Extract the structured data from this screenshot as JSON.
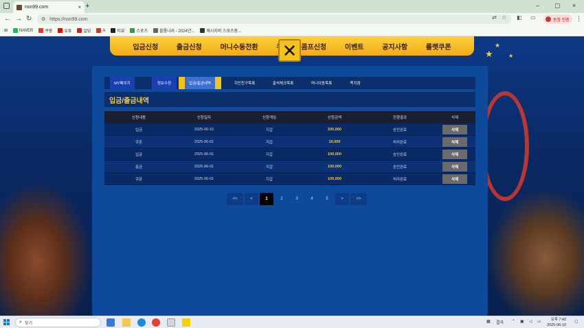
{
  "browser": {
    "tab_title": "nsn99.com",
    "tab_close": "×",
    "new_tab": "+",
    "url": "https://nsn99.com",
    "profile_label": "동창 인증",
    "win_min": "–",
    "win_max": "▢",
    "win_close": "×",
    "bookmarks": [
      {
        "label": "NAVER",
        "color": "#03c75a"
      },
      {
        "label": "쿠팡",
        "color": "#e33"
      },
      {
        "label": "유튜",
        "color": "#e00"
      },
      {
        "label": "일당",
        "color": "#c22"
      },
      {
        "label": "A",
        "color": "#c33"
      },
      {
        "label": "티뷰",
        "color": "#222"
      },
      {
        "label": "스포츠",
        "color": "#3a9a3a"
      },
      {
        "label": "블룸나라 - 2024년...",
        "color": "#666"
      },
      {
        "label": "해시지버 스포츠중...",
        "color": "#333"
      }
    ]
  },
  "topnav": {
    "items": [
      "입금신청",
      "출금신청",
      "머니수동전환",
      "쿠",
      "콤프신청",
      "이벤트",
      "공지사항",
      "룰렛쿠폰"
    ],
    "close_glyph": "✕"
  },
  "subtabs": [
    {
      "label": "MY페이지",
      "style": "blue"
    },
    {
      "label": "",
      "style": "plain"
    },
    {
      "label": "정보수정",
      "style": "blue"
    },
    {
      "label": "입금/출금내역",
      "style": "active"
    },
    {
      "label": "지인친구목록",
      "style": "plain"
    },
    {
      "label": "출석체크목록",
      "style": "plain"
    },
    {
      "label": "머니이동목록",
      "style": "plain"
    },
    {
      "label": "쪽지함",
      "style": "plain"
    }
  ],
  "section_title": "입금/출금내역",
  "table": {
    "headers": [
      "신청내용",
      "신청일자",
      "신청게임",
      "신청금액",
      "진행결과",
      "삭제"
    ],
    "rows": [
      {
        "type": "입금",
        "date": "2025-06-10",
        "game": "지갑",
        "amount": "200,000",
        "status": "승인완료",
        "action": "삭제"
      },
      {
        "type": "쿠폰",
        "date": "2025-06-01",
        "game": "지갑",
        "amount": "10,000",
        "status": "처리완료",
        "action": "삭제"
      },
      {
        "type": "입금",
        "date": "2025-06-01",
        "game": "지갑",
        "amount": "100,000",
        "status": "승인완료",
        "action": "삭제"
      },
      {
        "type": "출금",
        "date": "2025-06-01",
        "game": "지갑",
        "amount": "100,000",
        "status": "승인완료",
        "action": "삭제"
      },
      {
        "type": "쿠폰",
        "date": "2025-06-01",
        "game": "지갑",
        "amount": "100,000",
        "status": "처리완료",
        "action": "삭제"
      }
    ]
  },
  "pagination": {
    "first": "<<",
    "prev": "<",
    "pages": [
      "1",
      "2",
      "3",
      "4",
      "5"
    ],
    "current": "1",
    "next": ">",
    "last": ">>"
  },
  "taskbar": {
    "search_label": "찾기",
    "weather": "결과",
    "time": "오후 7:42",
    "date": "2025-06-10"
  }
}
